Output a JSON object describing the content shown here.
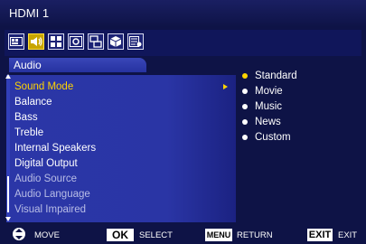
{
  "header": {
    "title": "HDMI 1"
  },
  "icon_bar": {
    "icons": [
      {
        "name": "picture-icon",
        "active": false
      },
      {
        "name": "audio-speaker-icon",
        "active": true
      },
      {
        "name": "grid-icon",
        "active": false
      },
      {
        "name": "settings-icon",
        "active": false
      },
      {
        "name": "network-icon",
        "active": false
      },
      {
        "name": "box-icon",
        "active": false
      },
      {
        "name": "list-icon",
        "active": false
      }
    ]
  },
  "section": {
    "title": "Audio"
  },
  "menu": {
    "items": [
      {
        "label": "Sound Mode",
        "state": "selected"
      },
      {
        "label": "Balance",
        "state": "enabled"
      },
      {
        "label": "Bass",
        "state": "enabled"
      },
      {
        "label": "Treble",
        "state": "enabled"
      },
      {
        "label": "Internal Speakers",
        "state": "enabled"
      },
      {
        "label": "Digital Output",
        "state": "enabled"
      },
      {
        "label": "Audio Source",
        "state": "dimmed"
      },
      {
        "label": "Audio Language",
        "state": "dimmed"
      },
      {
        "label": "Visual Impaired",
        "state": "dimmed"
      }
    ]
  },
  "options": {
    "items": [
      {
        "label": "Standard",
        "current": true
      },
      {
        "label": "Movie",
        "current": false
      },
      {
        "label": "Music",
        "current": false
      },
      {
        "label": "News",
        "current": false
      },
      {
        "label": "Custom",
        "current": false
      }
    ]
  },
  "footer": {
    "move_label": "MOVE",
    "ok_key": "OK",
    "select_label": "SELECT",
    "menu_key": "MENU",
    "return_label": "RETURN",
    "exit_key": "EXIT",
    "exit_label": "EXIT"
  },
  "colors": {
    "background": "#0e1346",
    "panel": "#2b36a7",
    "highlight": "#ffd400",
    "active_icon": "#c8a500"
  }
}
